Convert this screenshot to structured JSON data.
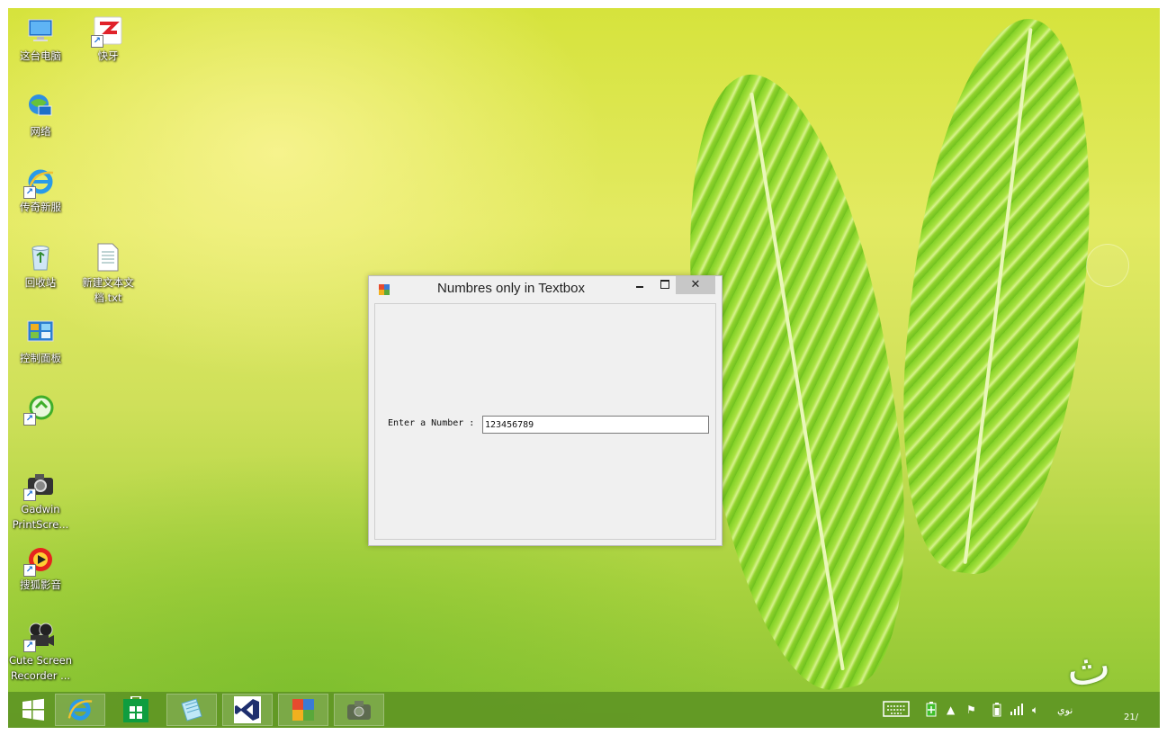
{
  "desktop": {
    "icons": [
      {
        "label": "这台电脑",
        "icon": "computer-icon"
      },
      {
        "label": "快牙",
        "icon": "kuaiya-icon"
      },
      {
        "label": "网络",
        "icon": "network-icon"
      },
      {
        "label": "传奇新服",
        "icon": "ie-icon"
      },
      {
        "label": "回收站",
        "icon": "recycle-bin-icon"
      },
      {
        "label": "新建文本文档.txt",
        "icon": "text-file-icon"
      },
      {
        "label": "控制面板",
        "icon": "control-panel-icon"
      },
      {
        "label": "",
        "icon": "app-shortcut-icon"
      },
      {
        "label": "Gadwin PrintScre...",
        "icon": "camera-icon"
      },
      {
        "label": "搜狐影音",
        "icon": "sohu-video-icon"
      },
      {
        "label": "Cute Screen Recorder ...",
        "icon": "film-reel-icon"
      }
    ]
  },
  "dialog": {
    "title": "Numbres only in Textbox",
    "close_glyph": "✕",
    "label": "Enter a Number :",
    "input_value": "123456789"
  },
  "taskbar": {
    "items": [
      "start-icon",
      "internet-explorer-icon",
      "store-icon",
      "notepad-icon",
      "visual-studio-icon",
      "windows-form-app-icon",
      "camera-icon"
    ],
    "tray_text": "نوي",
    "clock_date": "21/"
  },
  "watermark": "تاثوري",
  "colors": {
    "taskbar": "#609624",
    "dialog_bg": "#f0f0f0",
    "close_btn": "#c7c7c7",
    "leaf": "#8fd32c"
  }
}
